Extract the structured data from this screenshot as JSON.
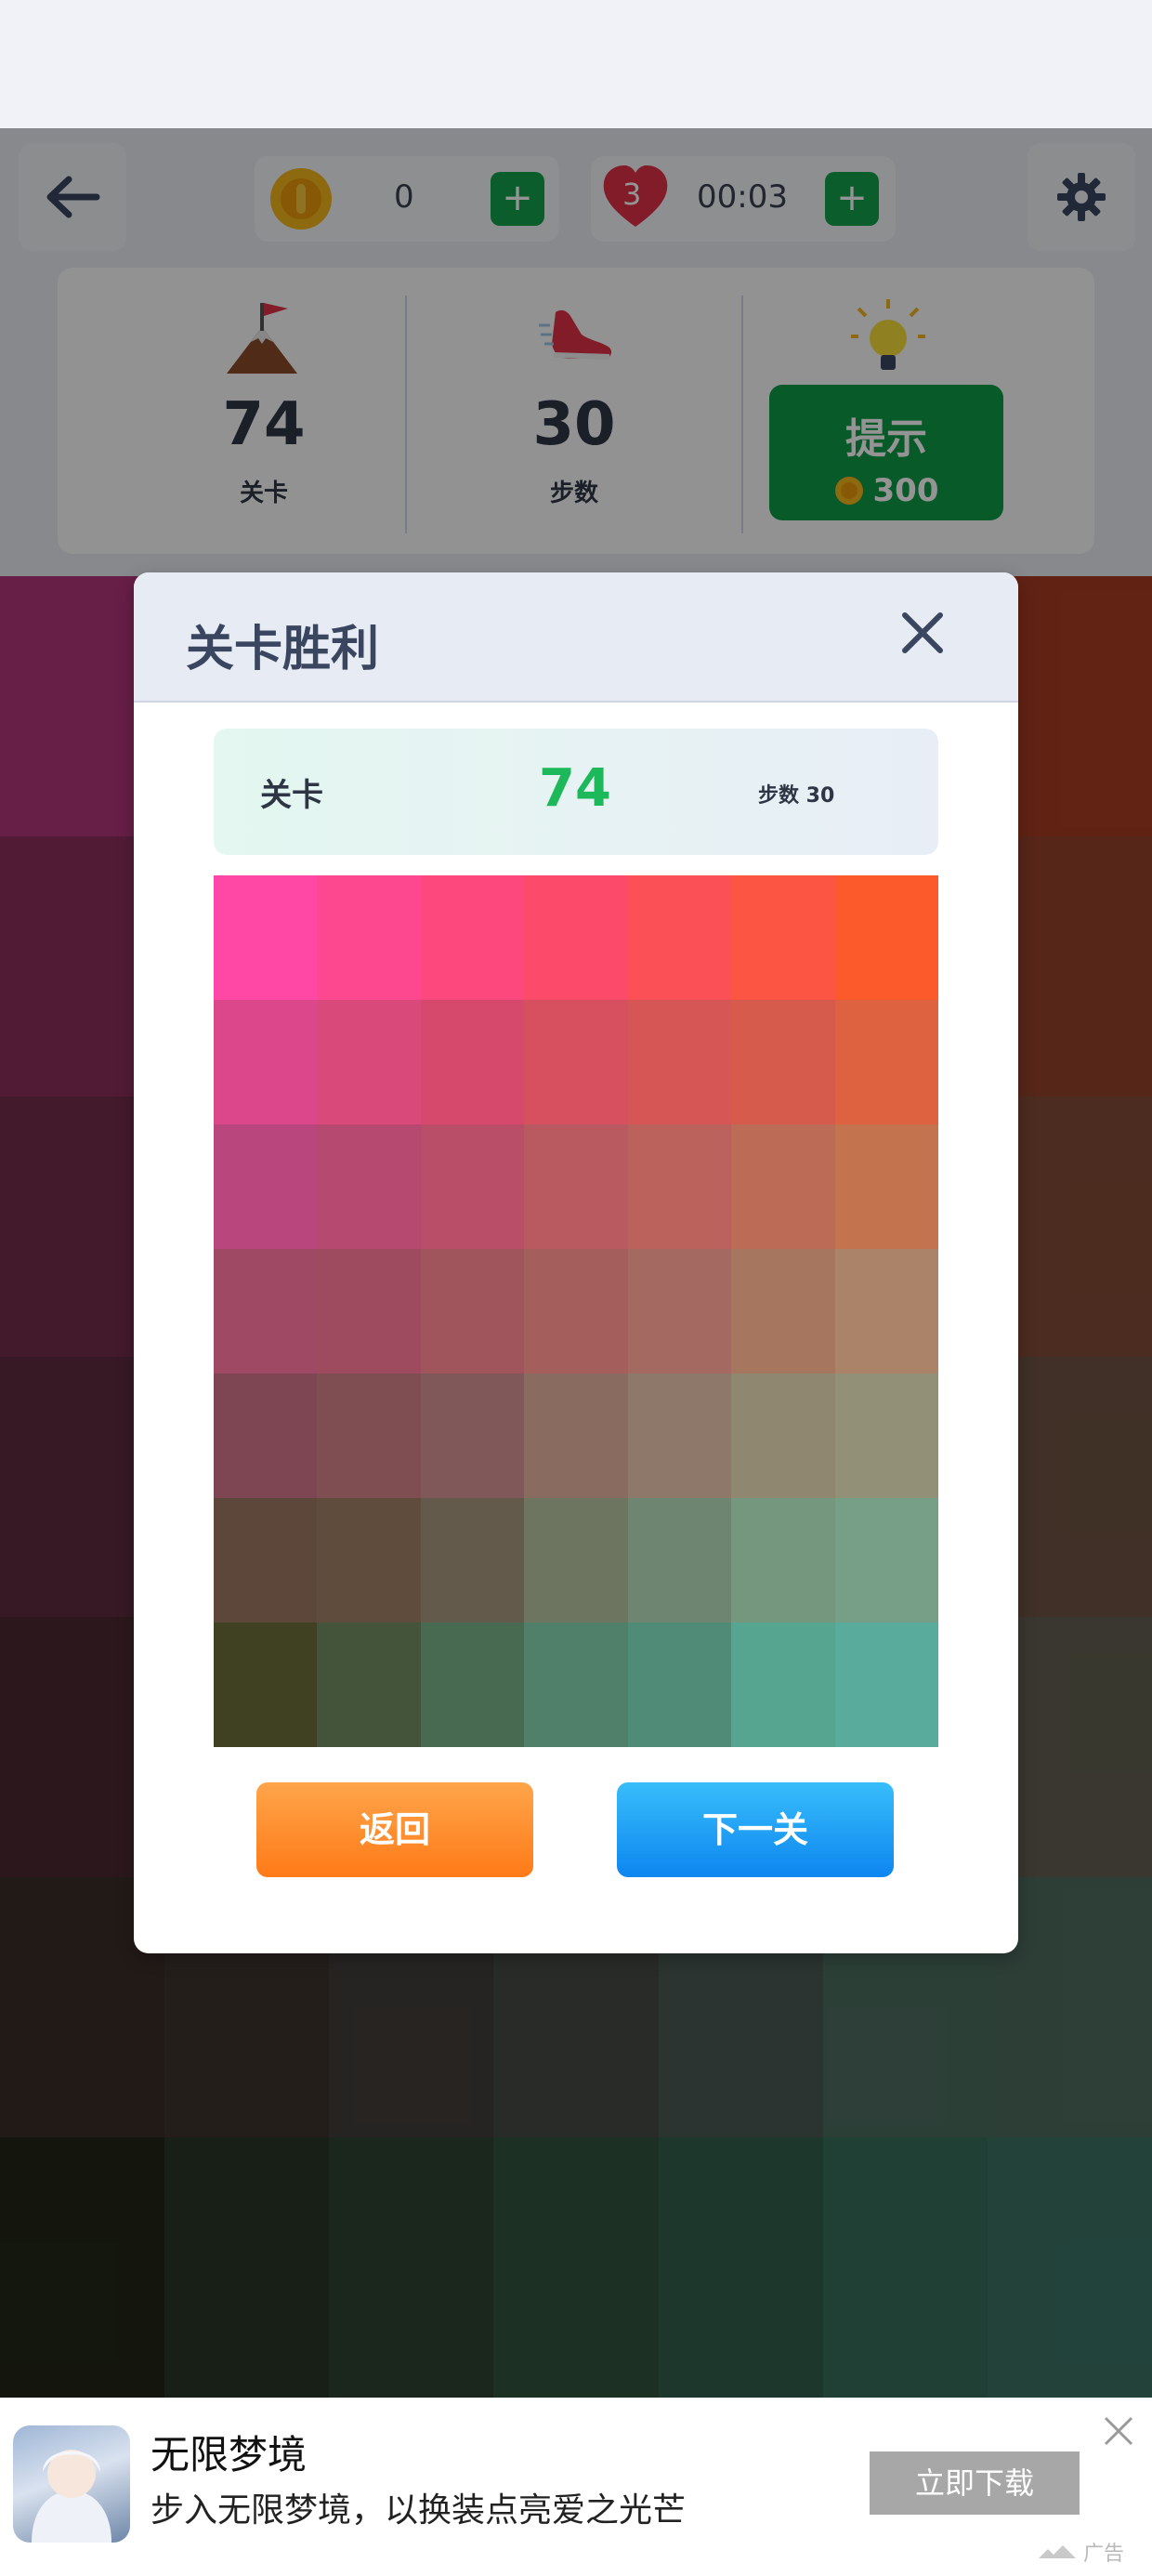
{
  "header": {
    "coins": "0",
    "lives": "3",
    "timer": "00:03",
    "plus_label": "+"
  },
  "stats": {
    "level": "74",
    "level_label": "关卡",
    "steps": "30",
    "steps_label": "步数",
    "hint_label": "提示",
    "hint_cost": "300"
  },
  "dialog": {
    "title": "关卡胜利",
    "level_label": "关卡",
    "level_value": "74",
    "steps_text": "步数 30",
    "back_label": "返回",
    "next_label": "下一关",
    "grid_colors": [
      [
        "#ff47a6",
        "#fd4890",
        "#fc487d",
        "#fb4a6a",
        "#fb5056",
        "#fc5544",
        "#fd5a2b"
      ],
      [
        "#dc478c",
        "#d94a7b",
        "#d7496c",
        "#d6505f",
        "#d65655",
        "#d75b4d",
        "#de6140"
      ],
      [
        "#b9477e",
        "#b5496f",
        "#b84e67",
        "#b95a60",
        "#bc625c",
        "#bc6b57",
        "#c4734f"
      ],
      [
        "#a04965",
        "#9e4a5f",
        "#a0545b",
        "#a45e5c",
        "#a46a62",
        "#a6765f",
        "#aa8369"
      ],
      [
        "#7e4653",
        "#7f4e52",
        "#80585a",
        "#896b60",
        "#8d786a",
        "#8f876f",
        "#929076"
      ],
      [
        "#5d473b",
        "#5f4c3d",
        "#645a4b",
        "#6d7460",
        "#6e8572",
        "#74977e",
        "#779e86"
      ],
      [
        "#3f4122",
        "#44543a",
        "#486a50",
        "#50806a",
        "#4f8b76",
        "#56a590",
        "#59ac9c"
      ]
    ]
  },
  "board": {
    "colors": [
      [
        "#b1347b",
        "#ae3a6f",
        "#b04463",
        "#b24e59",
        "#b55a52",
        "#b9654b",
        "#a83c24"
      ],
      [
        "#8c2f5e",
        "#8b355a",
        "#8b3e55",
        "#8c4a52",
        "#8e5550",
        "#8e5f4d",
        "#94422b"
      ],
      [
        "#742b4d",
        "#712e4a",
        "#723649",
        "#754349",
        "#774e4d",
        "#7b5c51",
        "#844c37"
      ],
      [
        "#5e2b3f",
        "#5e2f3d",
        "#62383f",
        "#654545",
        "#69534f",
        "#6d6157",
        "#6e5444"
      ],
      [
        "#4c2a31",
        "#4d3135",
        "#523b3d",
        "#574a48",
        "#5e5b54",
        "#61655a",
        "#626051"
      ],
      [
        "#3b2d28",
        "#3e3430",
        "#433e3b",
        "#474a46",
        "#4b5a53",
        "#4d6d60",
        "#4f6c5f"
      ],
      [
        "#232717",
        "#2a3626",
        "#2f4331",
        "#32533f",
        "#33604c",
        "#376f5d",
        "#3b7365"
      ]
    ]
  },
  "ad": {
    "title": "无限梦境",
    "description": "步入无限梦境，以换装点亮爱之光芒",
    "cta_label": "立即下载",
    "tag": "广告"
  }
}
